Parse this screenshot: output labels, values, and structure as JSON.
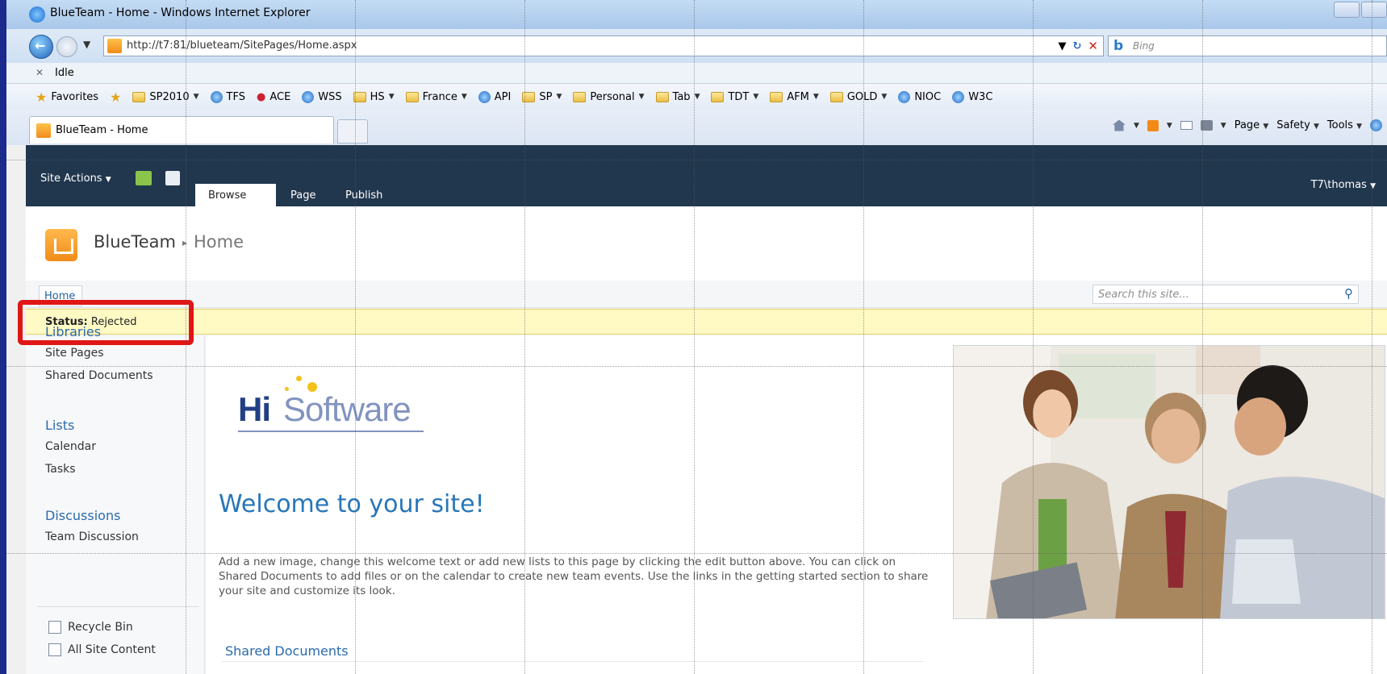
{
  "browser": {
    "window_title": "BlueTeam - Home - Windows Internet Explorer",
    "url": "http://t7:81/blueteam/SitePages/Home.aspx",
    "search_placeholder": "Bing",
    "status_text": "Idle",
    "tab_label": "BlueTeam - Home",
    "favorites_label": "Favorites",
    "favorites": [
      {
        "label": "SP2010",
        "icon": "folder-icon",
        "dropdown": true
      },
      {
        "label": "TFS",
        "icon": "ie-page-icon",
        "dropdown": false
      },
      {
        "label": "ACE",
        "icon": "ace-icon",
        "dropdown": false
      },
      {
        "label": "WSS",
        "icon": "ie-page-icon",
        "dropdown": false
      },
      {
        "label": "HS",
        "icon": "folder-icon",
        "dropdown": true
      },
      {
        "label": "France",
        "icon": "folder-icon",
        "dropdown": true
      },
      {
        "label": "API",
        "icon": "ie-page-icon",
        "dropdown": false
      },
      {
        "label": "SP",
        "icon": "folder-icon",
        "dropdown": true
      },
      {
        "label": "Personal",
        "icon": "folder-icon",
        "dropdown": true
      },
      {
        "label": "Tab",
        "icon": "folder-icon",
        "dropdown": true
      },
      {
        "label": "TDT",
        "icon": "folder-icon",
        "dropdown": true
      },
      {
        "label": "AFM",
        "icon": "folder-icon",
        "dropdown": true
      },
      {
        "label": "GOLD",
        "icon": "folder-icon",
        "dropdown": true
      },
      {
        "label": "NIOC",
        "icon": "ie-page-icon",
        "dropdown": false
      },
      {
        "label": "W3C",
        "icon": "ie-page-icon",
        "dropdown": false
      }
    ],
    "command_bar": {
      "page": "Page",
      "safety": "Safety",
      "tools": "Tools"
    }
  },
  "sharepoint": {
    "site_actions": "Site Actions",
    "ribbon_tabs": {
      "browse": "Browse",
      "page": "Page",
      "publish": "Publish"
    },
    "user": "T7\\thomas",
    "site_name": "BlueTeam",
    "page_name": "Home",
    "top_nav_home": "Home",
    "search_placeholder": "Search this site...",
    "status_label": "Status:",
    "status_value": "Rejected",
    "quick_launch": {
      "libraries": "Libraries",
      "site_pages": "Site Pages",
      "shared_documents": "Shared Documents",
      "lists": "Lists",
      "calendar": "Calendar",
      "tasks": "Tasks",
      "discussions": "Discussions",
      "team_discussion": "Team Discussion",
      "recycle_bin": "Recycle Bin",
      "all_site_content": "All Site Content"
    },
    "logo": {
      "hi": "Hi",
      "rest": "Software"
    },
    "welcome_title": "Welcome to your site!",
    "welcome_body": "Add a new image, change this welcome text or add new lists to this page by clicking the edit button above. You can click on Shared Documents to add files or on the calendar to create new team events. Use the links in the getting started section to share your site and customize its look.",
    "shared_documents_heading": "Shared Documents"
  },
  "colors": {
    "ribbon": "#21374e",
    "status_bar": "#fff9c4",
    "highlight_box": "#e01616",
    "link": "#2a6aad"
  }
}
